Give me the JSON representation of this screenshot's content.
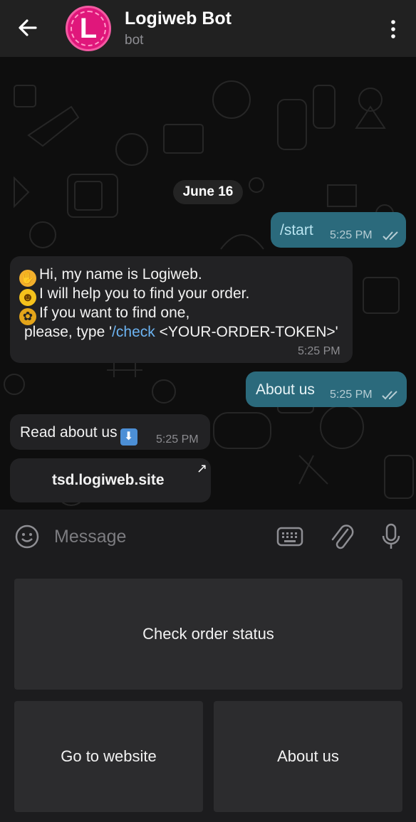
{
  "header": {
    "title": "Logiweb Bot",
    "subtitle": "bot",
    "avatar_letter": "L",
    "avatar_color": "#e0177b"
  },
  "chat": {
    "date_chip": "June 16",
    "messages": [
      {
        "direction": "out",
        "text": "/start",
        "time": "5:25 PM",
        "status": "read"
      },
      {
        "direction": "in",
        "lines": [
          {
            "emoji": "waving-hand",
            "text": "Hi, my name is Logiweb."
          },
          {
            "emoji": "grinning-face",
            "text": "I will help you to find your order."
          },
          {
            "emoji": "bee",
            "text": "If you want to find one,"
          },
          {
            "prefix": "please, type '",
            "command": "/check",
            "suffix": " <YOUR-ORDER-TOKEN>'"
          }
        ],
        "time": "5:25 PM"
      },
      {
        "direction": "out",
        "text": "About us",
        "time": "5:25 PM",
        "status": "read"
      },
      {
        "direction": "in",
        "text": "Read about us",
        "emoji": "down-arrow-button",
        "time": "5:25 PM"
      },
      {
        "direction": "in",
        "type": "url-button",
        "text": "tsd.logiweb.site"
      }
    ]
  },
  "composer": {
    "placeholder": "Message"
  },
  "keyboard": {
    "buttons": [
      "Check order status",
      "Go to website",
      "About us"
    ]
  },
  "colors": {
    "header_bg": "#212121",
    "outgoing_bubble": "#2b6a7c",
    "incoming_bubble": "#222224",
    "link": "#6cb3f1",
    "keyboard_button": "#2c2c2e"
  }
}
